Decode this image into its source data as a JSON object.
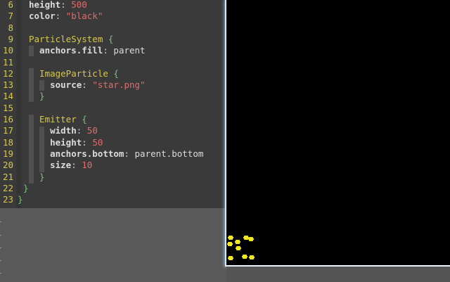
{
  "editor": {
    "lines": [
      {
        "n": "6",
        "tokens": [
          {
            "c": "k",
            "t": "height"
          },
          {
            "c": "p",
            "t": ": "
          },
          {
            "c": "n",
            "t": "500"
          }
        ]
      },
      {
        "n": "7",
        "tokens": [
          {
            "c": "k",
            "t": "color"
          },
          {
            "c": "p",
            "t": ": "
          },
          {
            "c": "s",
            "t": "\"black\""
          }
        ]
      },
      {
        "n": "8",
        "tokens": []
      },
      {
        "n": "9",
        "tokens": [
          {
            "c": "t",
            "t": "ParticleSystem"
          },
          {
            "c": "b",
            "t": " {"
          }
        ]
      },
      {
        "n": "10",
        "tokens": [
          {
            "c": "k",
            "t": "  anchors.fill"
          },
          {
            "c": "p",
            "t": ": "
          },
          {
            "c": "v",
            "t": "parent"
          }
        ]
      },
      {
        "n": "11",
        "tokens": []
      },
      {
        "n": "12",
        "tokens": [
          {
            "c": "t",
            "t": "  ImageParticle"
          },
          {
            "c": "b",
            "t": " {"
          }
        ]
      },
      {
        "n": "13",
        "tokens": [
          {
            "c": "k",
            "t": "    source"
          },
          {
            "c": "p",
            "t": ": "
          },
          {
            "c": "s",
            "t": "\"star.png\""
          }
        ]
      },
      {
        "n": "14",
        "tokens": [
          {
            "c": "b",
            "t": "  }"
          }
        ]
      },
      {
        "n": "15",
        "tokens": []
      },
      {
        "n": "16",
        "tokens": [
          {
            "c": "t",
            "t": "  Emitter"
          },
          {
            "c": "b",
            "t": " {"
          }
        ]
      },
      {
        "n": "17",
        "tokens": [
          {
            "c": "k",
            "t": "    width"
          },
          {
            "c": "p",
            "t": ": "
          },
          {
            "c": "n",
            "t": "50"
          }
        ]
      },
      {
        "n": "18",
        "tokens": [
          {
            "c": "k",
            "t": "    height"
          },
          {
            "c": "p",
            "t": ": "
          },
          {
            "c": "n",
            "t": "50"
          }
        ]
      },
      {
        "n": "19",
        "tokens": [
          {
            "c": "k",
            "t": "    anchors.bottom"
          },
          {
            "c": "p",
            "t": ": "
          },
          {
            "c": "v",
            "t": "parent.bottom"
          }
        ]
      },
      {
        "n": "20",
        "tokens": [
          {
            "c": "k",
            "t": "    size"
          },
          {
            "c": "p",
            "t": ": "
          },
          {
            "c": "n",
            "t": "10"
          }
        ]
      },
      {
        "n": "21",
        "tokens": [
          {
            "c": "b",
            "t": "  }"
          }
        ]
      },
      {
        "n": "22",
        "tokens": [
          {
            "c": "b",
            "t": "}"
          }
        ]
      },
      {
        "n": "23",
        "tokens": [
          {
            "c": "b",
            "t": "}"
          }
        ]
      }
    ]
  },
  "colors": {
    "line_number": "#d8c84a",
    "keyword": "#dcdcdc",
    "type": "#d8c84a",
    "number_string": "#e06c6c",
    "brace": "#7dc27d",
    "preview_background": "#000000",
    "particle": "#f2e81e"
  }
}
